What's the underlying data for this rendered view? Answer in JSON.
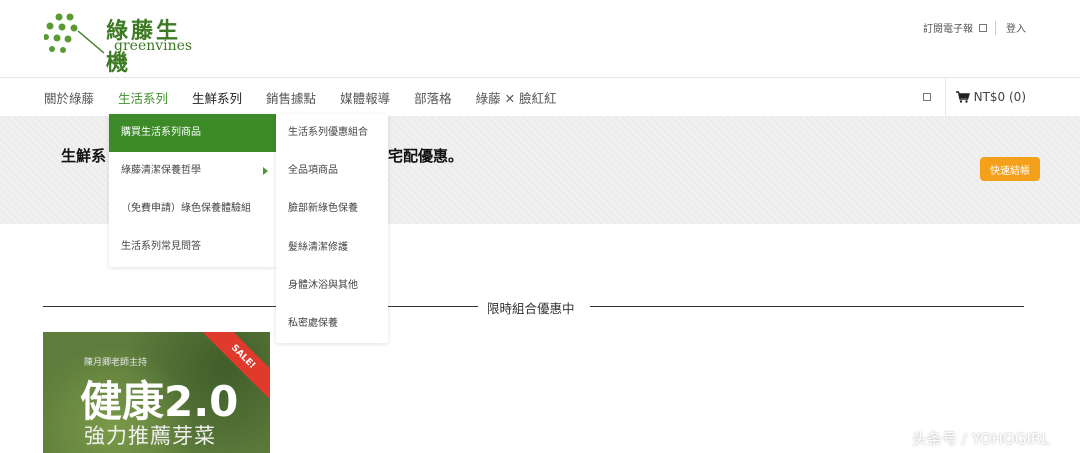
{
  "header": {
    "logo_cn": "綠藤生機",
    "logo_en": "greenvines",
    "subscribe": "訂閱電子報",
    "login": "登入"
  },
  "nav": {
    "items": [
      {
        "label": "關於綠藤"
      },
      {
        "label": "生活系列"
      },
      {
        "label": "生鮮系列"
      },
      {
        "label": "銷售據點"
      },
      {
        "label": "媒體報導"
      },
      {
        "label": "部落格"
      },
      {
        "label": "綠藤 ✕ 臉紅紅"
      }
    ],
    "cart": "NT$0 (0)"
  },
  "banner": {
    "text_left": "生鮮系",
    "text_mid": "宅配優惠。",
    "checkout": "快速結帳"
  },
  "dropdown_main": [
    {
      "label": "購買生活系列商品"
    },
    {
      "label": "綠藤清潔保養哲學"
    },
    {
      "label": "（免費申請）綠色保養體驗組"
    },
    {
      "label": "生活系列常見問答"
    }
  ],
  "dropdown_sub": [
    {
      "label": "生活系列優惠組合"
    },
    {
      "label": "全品項商品"
    },
    {
      "label": "臉部新綠色保養"
    },
    {
      "label": "髮絲清潔修護"
    },
    {
      "label": "身體沐浴與其他"
    },
    {
      "label": "私密處保養"
    }
  ],
  "section": {
    "title": "限時組合優惠中"
  },
  "product": {
    "subtitle": "陳月卿老師主持",
    "big": "健康2.0",
    "small": "強力推薦芽菜",
    "ribbon": "SALE!"
  },
  "watermark": "头条号 / YOHOGIRL",
  "colors": {
    "brand_green": "#3d7a24",
    "menu_selected": "#3d8a29",
    "checkout_orange": "#f5a01a",
    "ribbon_red": "#e03a2c"
  }
}
